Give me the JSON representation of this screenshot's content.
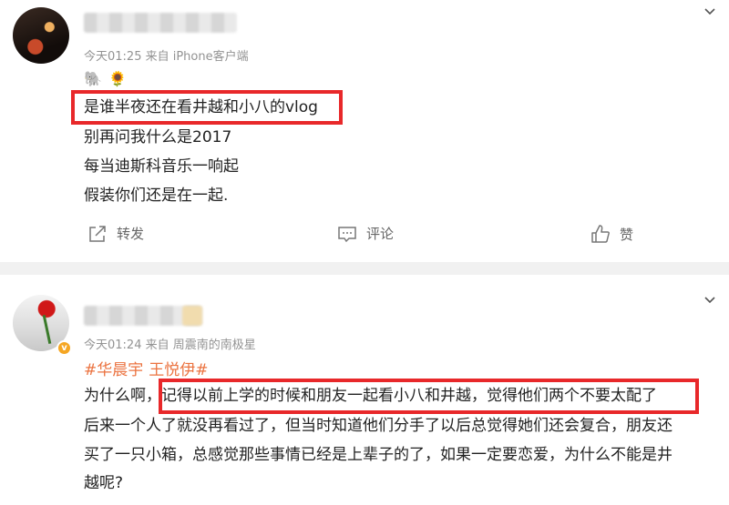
{
  "posts": [
    {
      "meta": "今天01:25  来自 iPhone客户端",
      "emojis": [
        "🐘",
        "🌻"
      ],
      "lines": [
        "是谁半夜还在看井越和小八的vlog",
        "别再问我什么是2017",
        "每当迪斯科音乐一响起",
        "假装你们还是在一起."
      ],
      "actions": {
        "repost": "转发",
        "comment": "评论",
        "like": "赞"
      }
    },
    {
      "meta": "今天01:24  来自 周震南的南极星",
      "tags": [
        "#华晨宇",
        "王悦伊#"
      ],
      "lines": [
        "为什么啊，记得以前上学的时候和朋友一起看小八和井越，觉得他们两个不要太配了",
        "后来一个人了就没再看过了，但当时知道他们分手了以后总觉得她们还会复合，朋友还",
        "买了一只小箱，总感觉那些事情已经是上辈子的了，如果一定要恋爱，为什么不能是井",
        "越呢?"
      ]
    }
  ],
  "colors": {
    "highlight": "#e8282a",
    "tag": "#eb7340",
    "meta": "#939393"
  }
}
